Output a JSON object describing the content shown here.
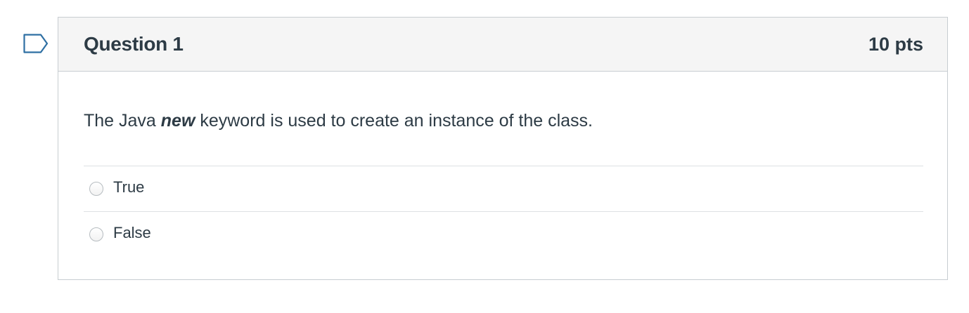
{
  "question": {
    "title": "Question 1",
    "points": "10 pts",
    "text_before": "The Java ",
    "text_emphasis": "new",
    "text_after": " keyword is used to create an instance of the class.",
    "answers": [
      {
        "label": "True"
      },
      {
        "label": "False"
      }
    ]
  },
  "icons": {
    "flag": "flag-icon"
  },
  "colors": {
    "text": "#2d3b45",
    "header_bg": "#f5f5f5",
    "border": "#c7cdd1",
    "flag_stroke": "#0b5f99"
  }
}
